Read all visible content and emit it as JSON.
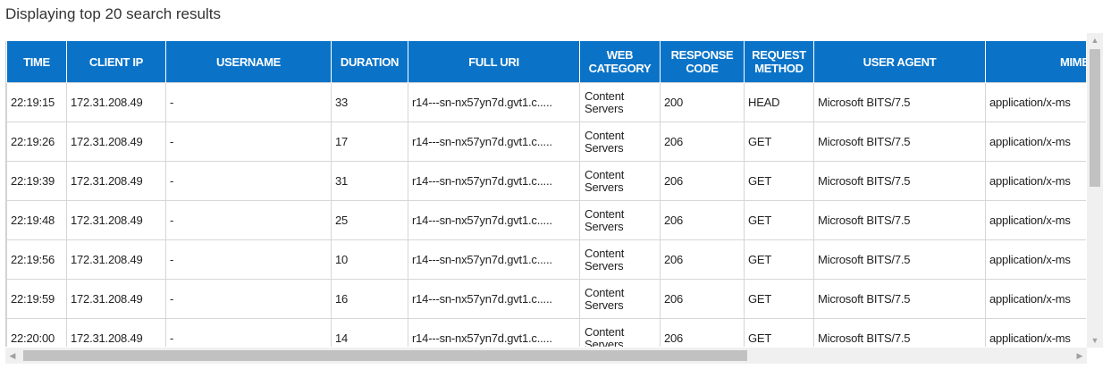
{
  "heading": "Displaying top 20 search results",
  "colors": {
    "header_bg": "#0a73c8",
    "header_text": "#ffffff",
    "grid": "#d6d6d6"
  },
  "columns": [
    {
      "label": "TIME"
    },
    {
      "label": "CLIENT IP"
    },
    {
      "label": "USERNAME"
    },
    {
      "label": "DURATION"
    },
    {
      "label": "FULL URI"
    },
    {
      "label": "WEB CATEGORY"
    },
    {
      "label": "RESPONSE CODE"
    },
    {
      "label": "REQUEST METHOD"
    },
    {
      "label": "USER AGENT"
    },
    {
      "label": "MIME TY"
    }
  ],
  "rows": [
    {
      "time": "22:19:15",
      "client_ip": "172.31.208.49",
      "username": "-",
      "duration": "33",
      "full_uri": "r14---sn-nx57yn7d.gvt1.c.....",
      "web_category": "Content Servers",
      "response_code": "200",
      "request_method": "HEAD",
      "user_agent": "Microsoft BITS/7.5",
      "mime_type": "application/x-ms"
    },
    {
      "time": "22:19:26",
      "client_ip": "172.31.208.49",
      "username": "-",
      "duration": "17",
      "full_uri": "r14---sn-nx57yn7d.gvt1.c.....",
      "web_category": "Content Servers",
      "response_code": "206",
      "request_method": "GET",
      "user_agent": "Microsoft BITS/7.5",
      "mime_type": "application/x-ms"
    },
    {
      "time": "22:19:39",
      "client_ip": "172.31.208.49",
      "username": "-",
      "duration": "31",
      "full_uri": "r14---sn-nx57yn7d.gvt1.c.....",
      "web_category": "Content Servers",
      "response_code": "206",
      "request_method": "GET",
      "user_agent": "Microsoft BITS/7.5",
      "mime_type": "application/x-ms"
    },
    {
      "time": "22:19:48",
      "client_ip": "172.31.208.49",
      "username": "-",
      "duration": "25",
      "full_uri": "r14---sn-nx57yn7d.gvt1.c.....",
      "web_category": "Content Servers",
      "response_code": "206",
      "request_method": "GET",
      "user_agent": "Microsoft BITS/7.5",
      "mime_type": "application/x-ms"
    },
    {
      "time": "22:19:56",
      "client_ip": "172.31.208.49",
      "username": "-",
      "duration": "10",
      "full_uri": "r14---sn-nx57yn7d.gvt1.c.....",
      "web_category": "Content Servers",
      "response_code": "206",
      "request_method": "GET",
      "user_agent": "Microsoft BITS/7.5",
      "mime_type": "application/x-ms"
    },
    {
      "time": "22:19:59",
      "client_ip": "172.31.208.49",
      "username": "-",
      "duration": "16",
      "full_uri": "r14---sn-nx57yn7d.gvt1.c.....",
      "web_category": "Content Servers",
      "response_code": "206",
      "request_method": "GET",
      "user_agent": "Microsoft BITS/7.5",
      "mime_type": "application/x-ms"
    },
    {
      "time": "22:20:00",
      "client_ip": "172.31.208.49",
      "username": "-",
      "duration": "14",
      "full_uri": "r14---sn-nx57yn7d.gvt1.c.....",
      "web_category": "Content Servers",
      "response_code": "206",
      "request_method": "GET",
      "user_agent": "Microsoft BITS/7.5",
      "mime_type": "application/x-ms"
    }
  ],
  "scrollbars": {
    "up_icon": "scroll-up-arrow-icon",
    "down_icon": "scroll-down-arrow-icon",
    "left_icon": "scroll-left-arrow-icon",
    "right_icon": "scroll-right-arrow-icon"
  }
}
